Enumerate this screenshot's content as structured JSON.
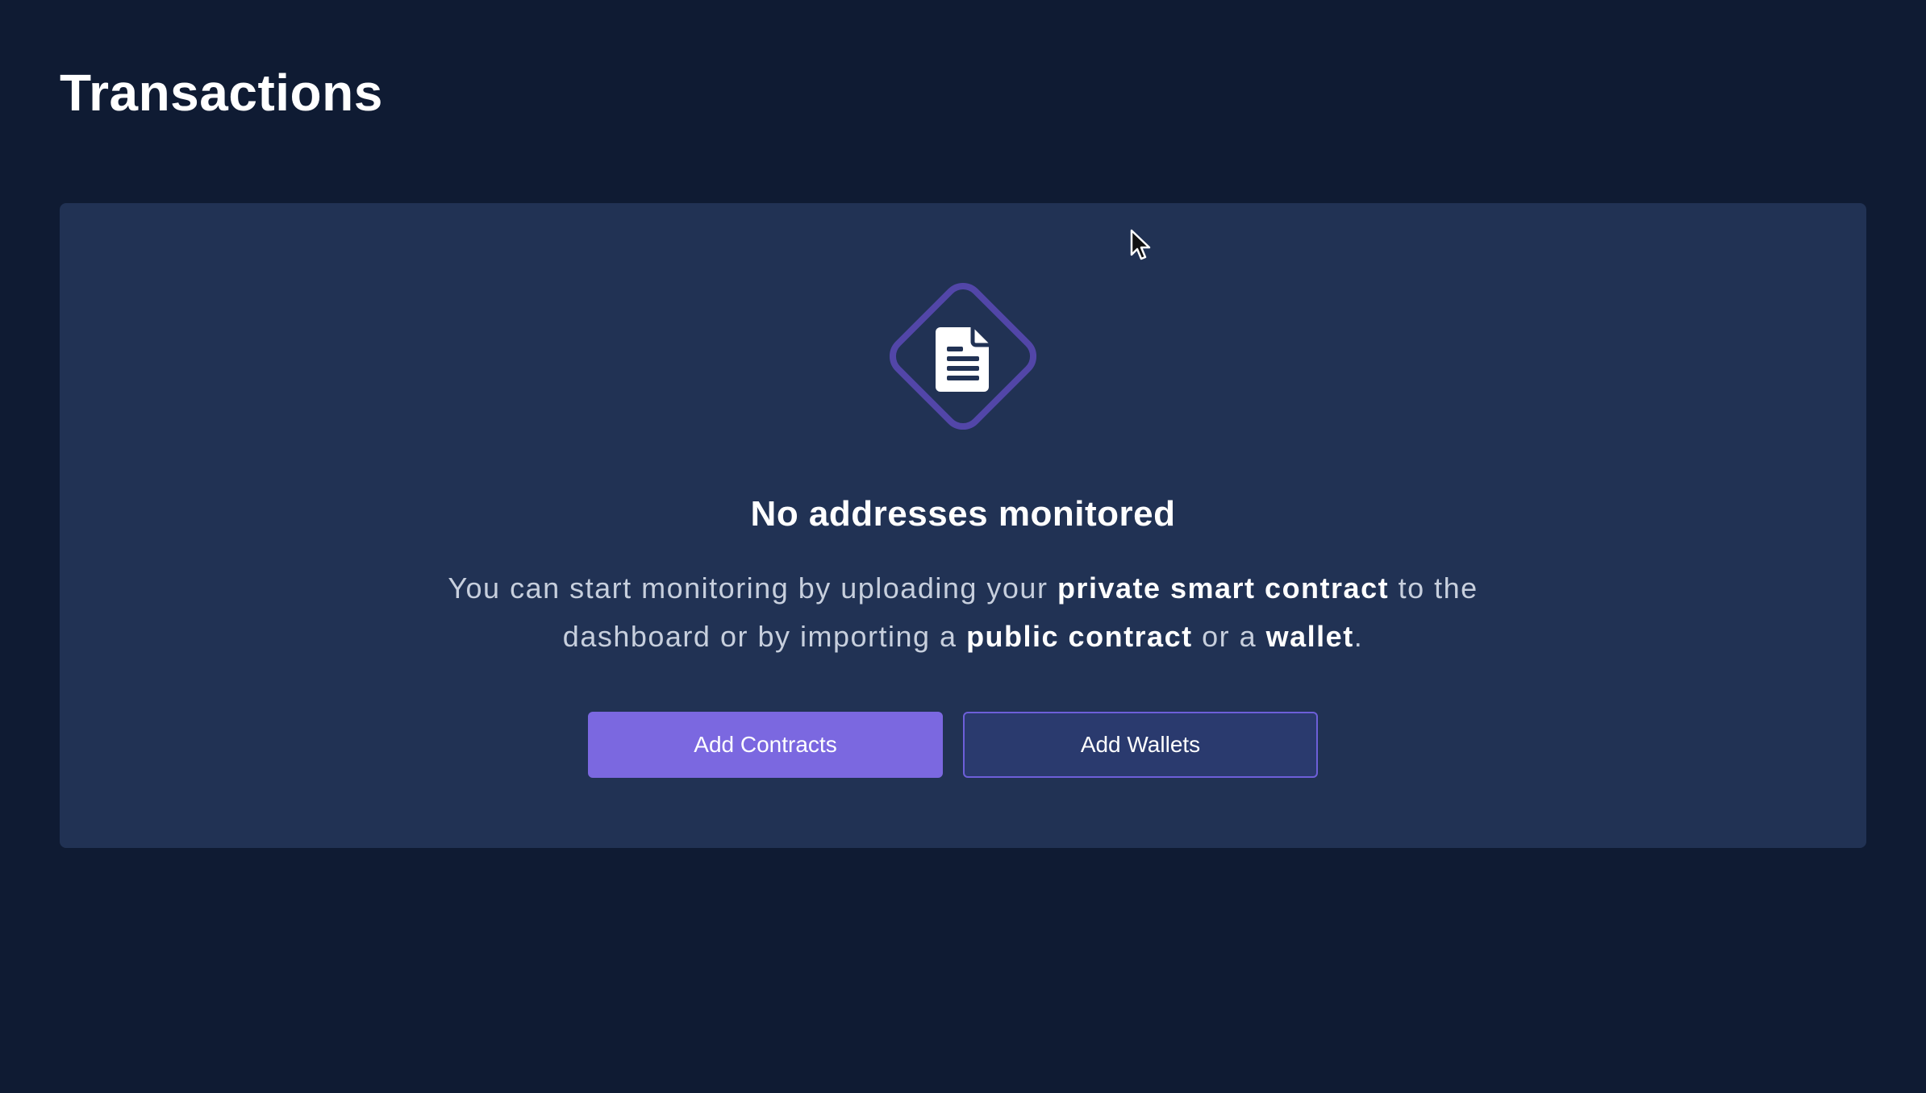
{
  "page": {
    "title": "Transactions"
  },
  "empty_state": {
    "icon": "document-icon",
    "title": "No addresses monitored",
    "description": {
      "part1": "You can start monitoring by uploading your ",
      "bold1": "private smart contract",
      "part2": " to the dashboard or by importing a ",
      "bold2": "public contract",
      "part3": " or a ",
      "bold3": "wallet",
      "part4": "."
    }
  },
  "actions": {
    "add_contracts_label": "Add Contracts",
    "add_wallets_label": "Add Wallets"
  },
  "colors": {
    "background": "#0f1b33",
    "panel": "#213254",
    "accent": "#7b68e0",
    "secondary_button": "#2a3a6e",
    "icon_border": "#5246a8"
  }
}
